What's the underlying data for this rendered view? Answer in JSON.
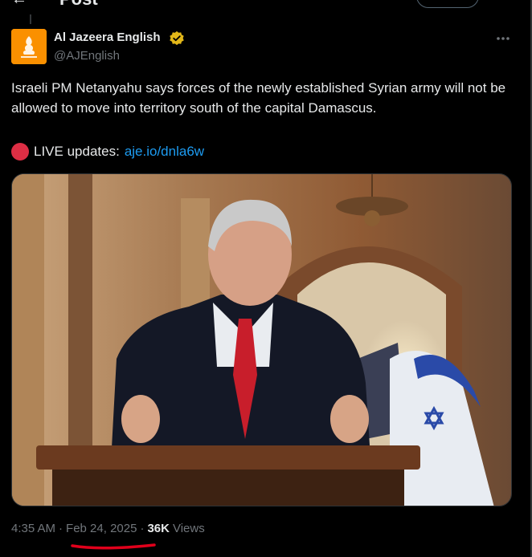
{
  "header": {
    "title": "Post"
  },
  "tweet": {
    "author_name": "Al Jazeera English",
    "author_handle": "@AJEnglish",
    "text": "Israeli PM Netanyahu says forces of the newly established Syrian army will not be allowed to move into territory south of the capital Damascus.",
    "live_label": "LIVE updates:",
    "live_link": "aje.io/dnla6w",
    "time": "4:35 AM",
    "date": "Feb 24, 2025",
    "views_count": "36K",
    "views_label": "Views",
    "separator": "·",
    "icons": {
      "avatar": "al-jazeera-logo",
      "verified": "gold-verified-badge-icon",
      "more": "more-horizontal-icon",
      "live": "red-circle-emoji"
    },
    "media_alt": "Photo of Netanyahu speaking at a podium with flags behind him"
  },
  "colors": {
    "background": "#000000",
    "text": "#e7e9ea",
    "muted": "#71767b",
    "link": "#1d9bf0",
    "verified_gold": "#e2b719",
    "live_red": "#dd2e44",
    "annotation_red": "#e0001b"
  }
}
